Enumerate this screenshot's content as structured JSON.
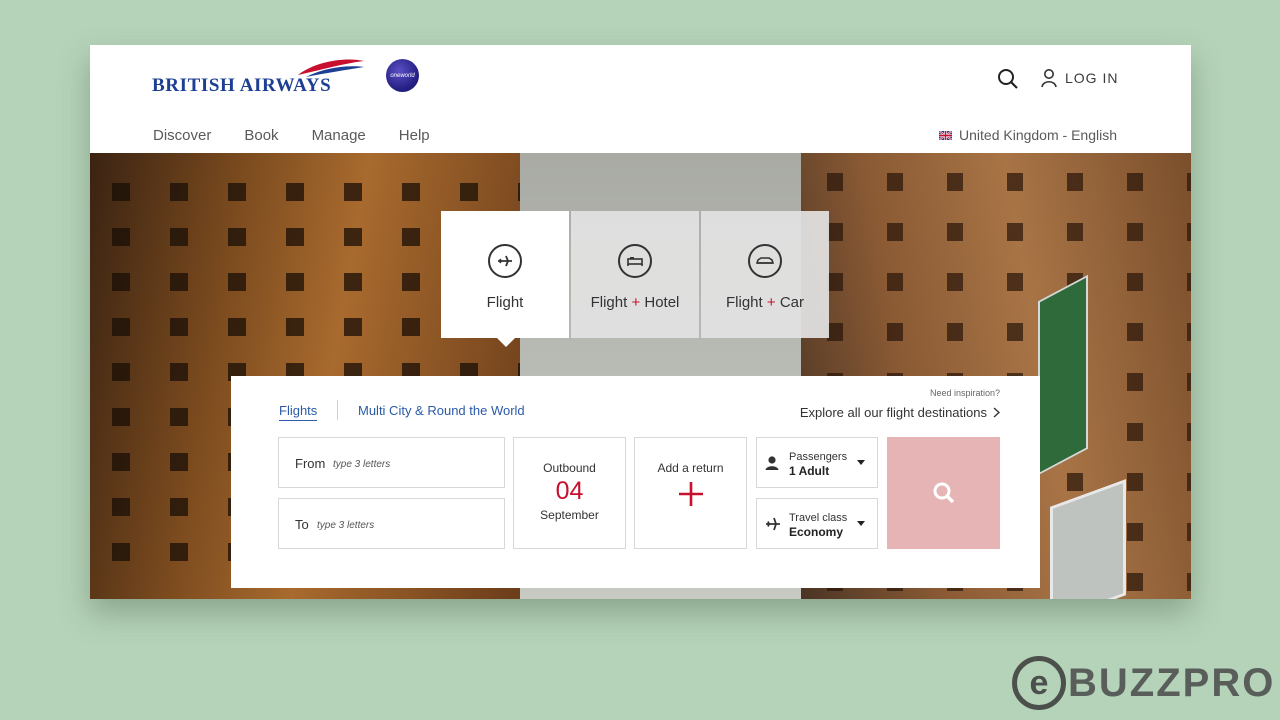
{
  "header": {
    "brand": "BRITISH AIRWAYS",
    "alliance": "oneworld",
    "login_label": "LOG IN",
    "locale": "United Kingdom - English"
  },
  "nav": [
    {
      "label": "Discover"
    },
    {
      "label": "Book"
    },
    {
      "label": "Manage"
    },
    {
      "label": "Help"
    }
  ],
  "product_tabs": [
    {
      "label": "Flight",
      "label_extra": "",
      "label_plus": ""
    },
    {
      "label": "Flight",
      "label_plus": "+",
      "label_extra": "Hotel"
    },
    {
      "label": "Flight",
      "label_plus": "+",
      "label_extra": "Car"
    }
  ],
  "booking": {
    "tab_flights": "Flights",
    "tab_multicity": "Multi City & Round the World",
    "need_inspiration": "Need inspiration?",
    "explore": "Explore all our flight destinations",
    "from_label": "From",
    "from_placeholder": "type 3 letters",
    "to_label": "To",
    "to_placeholder": "type 3 letters",
    "outbound_label": "Outbound",
    "outbound_day": "04",
    "outbound_month": "September",
    "return_label": "Add a return",
    "passengers_label": "Passengers",
    "passengers_value": "1 Adult",
    "class_label": "Travel class",
    "class_value": "Economy"
  },
  "colors": {
    "brand_blue": "#1c3f94",
    "accent_red": "#c8102e",
    "link_blue": "#2a5aa8",
    "search_button": "#e6b4b4"
  },
  "watermark": {
    "letter": "e",
    "text": "BUZZPRO"
  }
}
